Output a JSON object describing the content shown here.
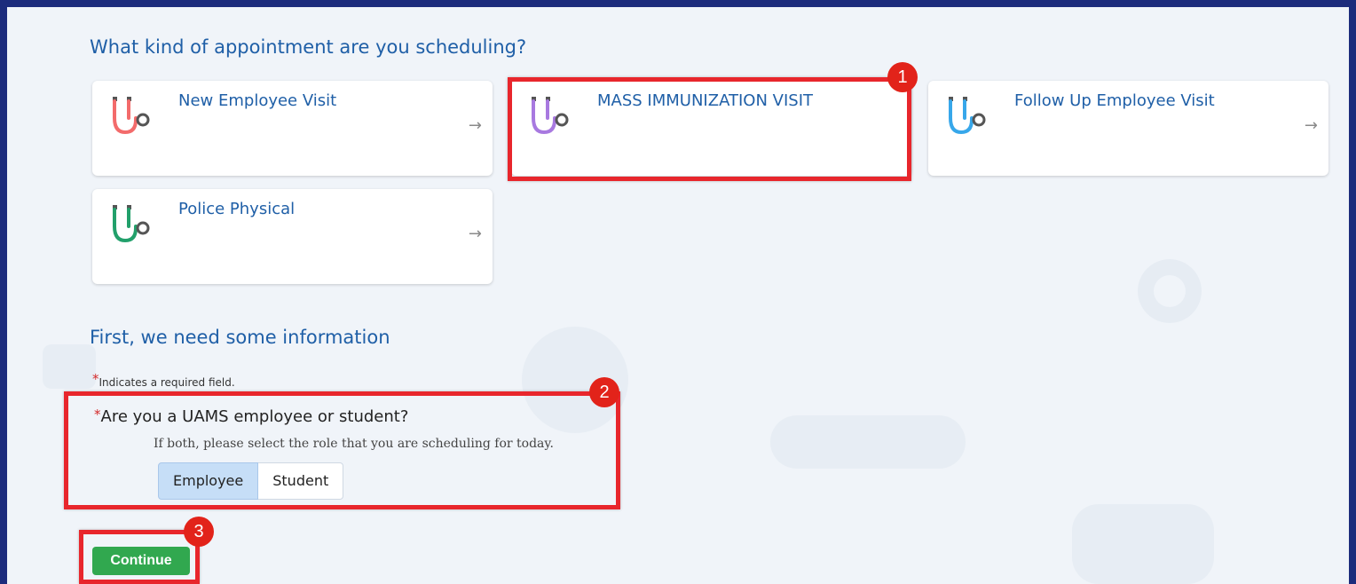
{
  "appointment": {
    "heading": "What kind of appointment are you scheduling?",
    "arrow_glyph": "→",
    "cards": [
      {
        "label": "New Employee Visit",
        "tube_color": "#f36b6b"
      },
      {
        "label": "MASS IMMUNIZATION VISIT",
        "tube_color": "#a879e0"
      },
      {
        "label": "Follow Up Employee Visit",
        "tube_color": "#37a7ea"
      },
      {
        "label": "Police Physical",
        "tube_color": "#22a06b"
      }
    ]
  },
  "info": {
    "heading": "First, we need some information",
    "required_star": "*",
    "required_note": "Indicates a required field.",
    "question": "Are you a UAMS employee or student?",
    "hint": "If both, please select the role that you are scheduling for today.",
    "options": [
      "Employee",
      "Student"
    ],
    "selected_option": "Employee"
  },
  "continue_label": "Continue",
  "callouts": [
    "1",
    "2",
    "3"
  ],
  "colors": {
    "border_blue": "#1c2c7c",
    "title_blue": "#1f5fa7",
    "highlight_red": "#e8262c",
    "continue_green": "#31a84f"
  }
}
